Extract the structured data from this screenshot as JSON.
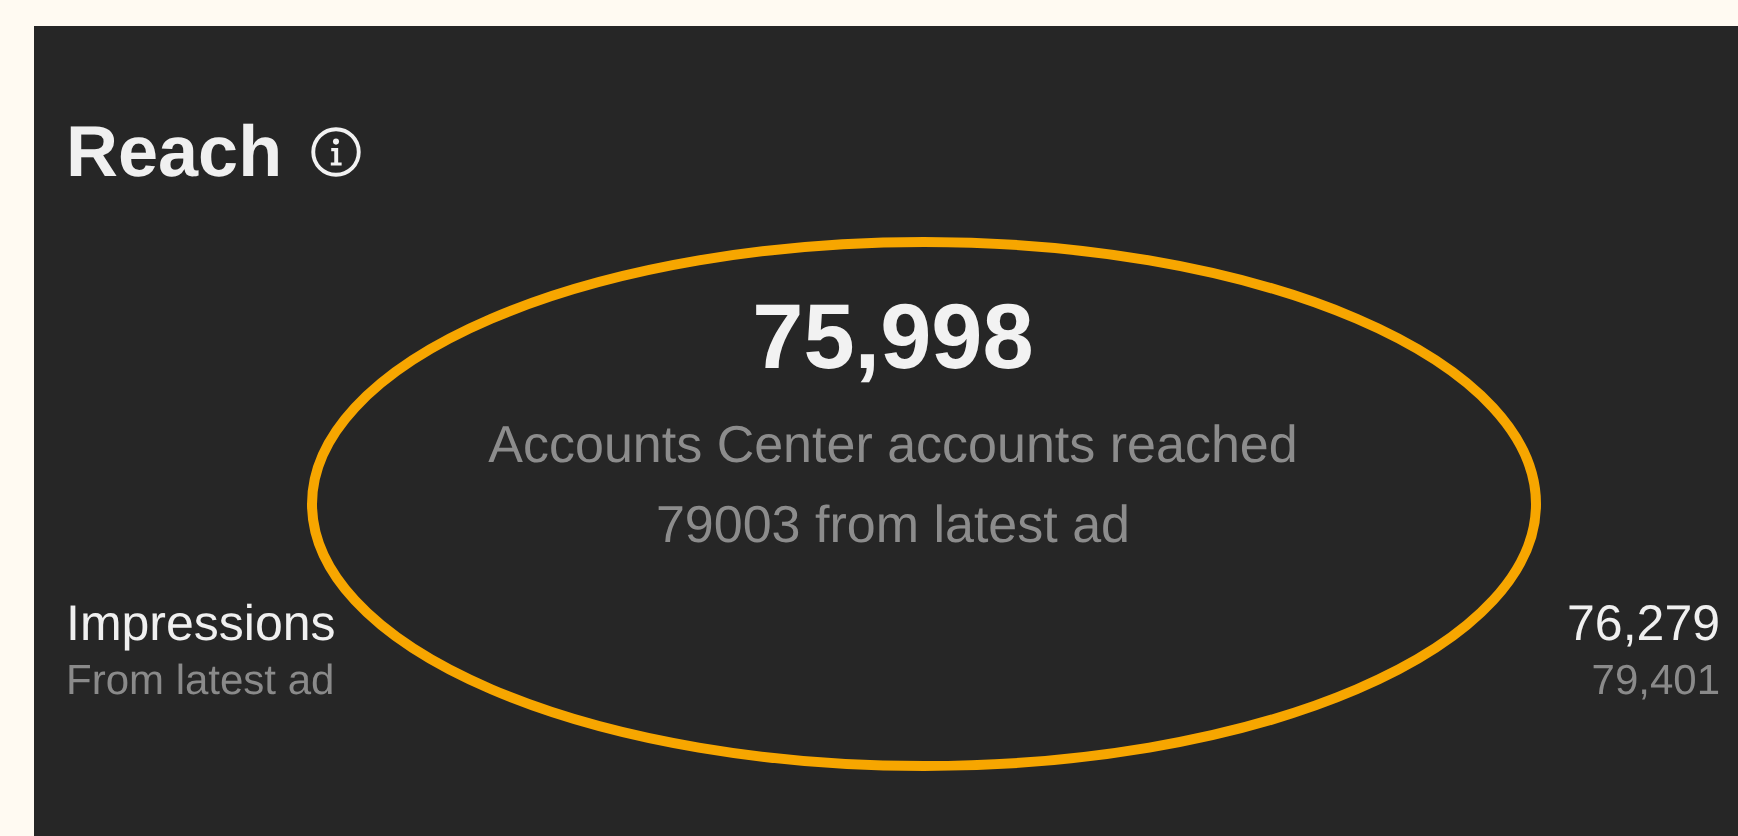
{
  "card": {
    "title": "Reach"
  },
  "highlight": {
    "value": "75,998",
    "label": "Accounts Center accounts reached",
    "note": "79003 from latest ad"
  },
  "metrics": [
    {
      "label": "Impressions",
      "value": "76,279",
      "sub_label": "From latest ad",
      "sub_value": "79,401"
    }
  ]
}
